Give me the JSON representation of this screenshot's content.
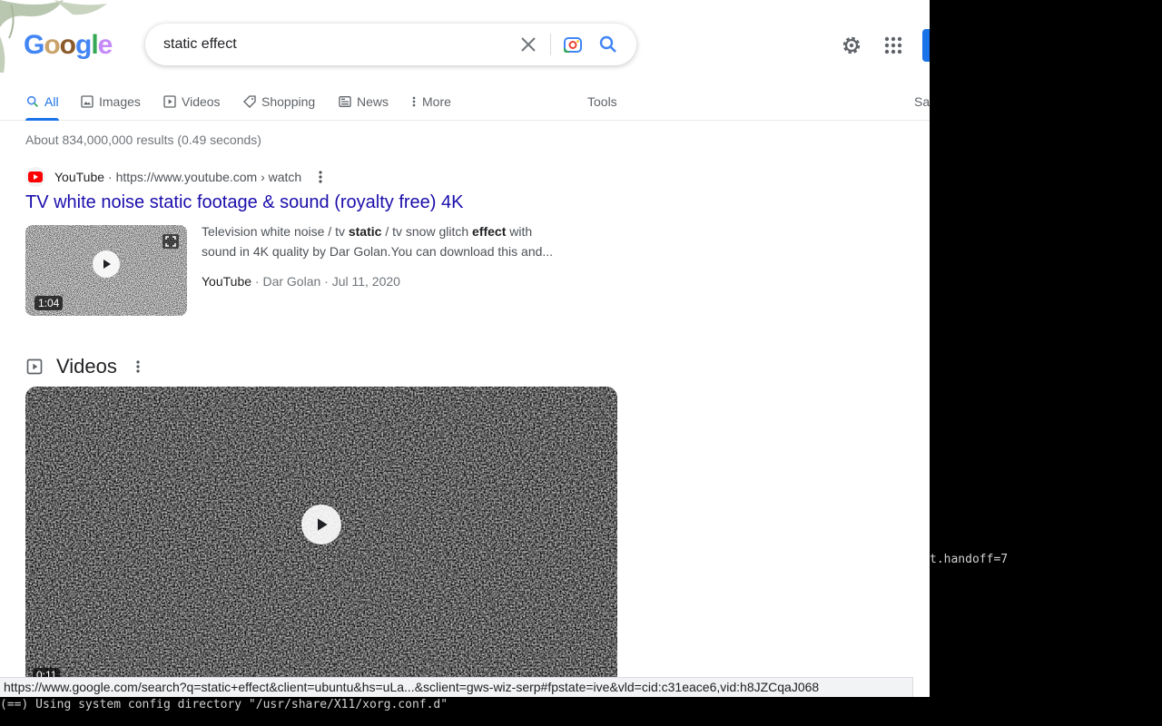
{
  "search": {
    "query": "static effect"
  },
  "tabs": [
    {
      "label": "All",
      "icon": "search-icon",
      "active": true
    },
    {
      "label": "Images",
      "icon": "image-icon"
    },
    {
      "label": "Videos",
      "icon": "video-icon"
    },
    {
      "label": "Shopping",
      "icon": "tag-icon"
    },
    {
      "label": "News",
      "icon": "news-icon"
    },
    {
      "label": "More",
      "icon": "more-vert-icon"
    }
  ],
  "tools_label": "Tools",
  "safesearch_label": "Sa",
  "result_stats": "About 834,000,000 results (0.49 seconds)",
  "result1": {
    "source_name": "YouTube",
    "source_url": "https://www.youtube.com › watch",
    "title": "TV white noise static footage & sound (royalty free) 4K",
    "snippet_parts": [
      "Television white noise / tv ",
      "static",
      " / tv snow glitch ",
      "effect",
      " with sound in 4K quality by Dar Golan.You can download this and..."
    ],
    "duration": "1:04",
    "meta_site": "YouTube",
    "meta_rest": " · Dar Golan · Jul 11, 2020"
  },
  "videos_section": {
    "title": "Videos",
    "first_duration": "0:11"
  },
  "status_url": "https://www.google.com/search?q=static+effect&client=ubuntu&hs=uLa...&sclient=gws-wiz-serp#fpstate=ive&vld=cid:c31eace6,vid:h8JZCqaJ068",
  "terminal": {
    "line_right": "t.handoff=7",
    "line_bottom": "(==) Using system config directory \"/usr/share/X11/xorg.conf.d\""
  },
  "colors": {
    "link": "#1a0dab",
    "accent": "#1a73e8",
    "youtube_red": "#ff0000"
  }
}
